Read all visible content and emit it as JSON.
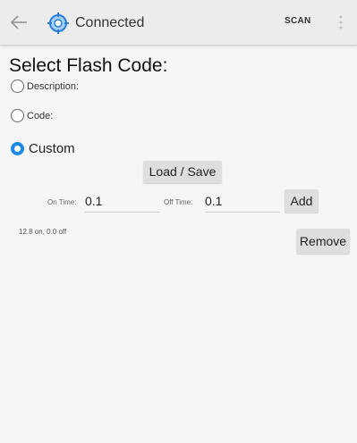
{
  "appbar": {
    "title": "Connected",
    "scan_label": "SCAN",
    "icons": {
      "back": "arrow-back-icon",
      "logo": "crosshair-target-icon",
      "overflow": "overflow-menu-icon"
    },
    "accent": "#1e88e5"
  },
  "heading": "Select Flash Code:",
  "options": [
    {
      "label": "Description:",
      "selected": false
    },
    {
      "label": "Code:",
      "selected": false
    },
    {
      "label": "Custom",
      "selected": true
    }
  ],
  "load_save_label": "Load / Save",
  "on_time": {
    "label": "On Time:",
    "value": "0.1"
  },
  "off_time": {
    "label": "Off Time:",
    "value": "0.1"
  },
  "add_label": "Add",
  "status_text": "12.8 on, 0.0 off",
  "remove_label": "Remove"
}
